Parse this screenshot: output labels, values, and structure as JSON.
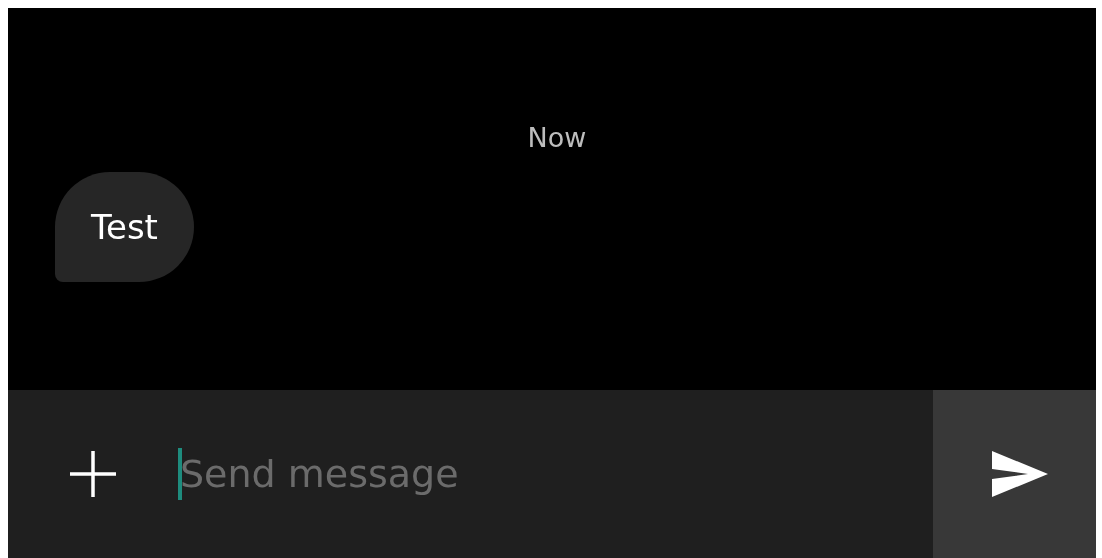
{
  "conversation": {
    "timestamp": "Now",
    "messages": [
      {
        "text": "Test",
        "kind": "incoming"
      }
    ]
  },
  "composer": {
    "placeholder": "Send message",
    "focused": true
  }
}
